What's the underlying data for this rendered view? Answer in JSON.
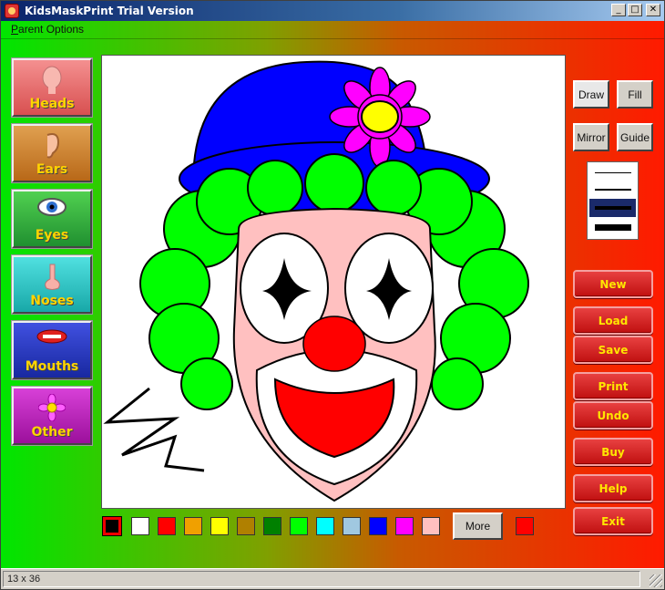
{
  "window": {
    "title": "KidsMaskPrint Trial Version"
  },
  "menu": {
    "parent_options_first": "P",
    "parent_options_rest": "arent Options"
  },
  "categories": [
    {
      "label": "Heads",
      "color": "#f07070"
    },
    {
      "label": "Ears",
      "color": "#d08830"
    },
    {
      "label": "Eyes",
      "color": "#30b040"
    },
    {
      "label": "Noses",
      "color": "#30c8c8"
    },
    {
      "label": "Mouths",
      "color": "#2838c0"
    },
    {
      "label": "Other",
      "color": "#c020c0"
    }
  ],
  "tools": {
    "draw": "Draw",
    "fill": "Fill",
    "mirror": "Mirror",
    "guide": "Guide"
  },
  "actions": [
    "New",
    "Load",
    "Save",
    "Print",
    "Undo",
    "Buy",
    "Help",
    "Exit"
  ],
  "palette": [
    "#000000",
    "#ffffff",
    "#ff0000",
    "#f0a000",
    "#ffff00",
    "#b08000",
    "#008000",
    "#00ff00",
    "#00ffff",
    "#a0c8e0",
    "#0000ff",
    "#ff00ff",
    "#ffc0c0"
  ],
  "more_button": "More",
  "current_color": "#ff0000",
  "status": {
    "text": "13 x 36"
  }
}
